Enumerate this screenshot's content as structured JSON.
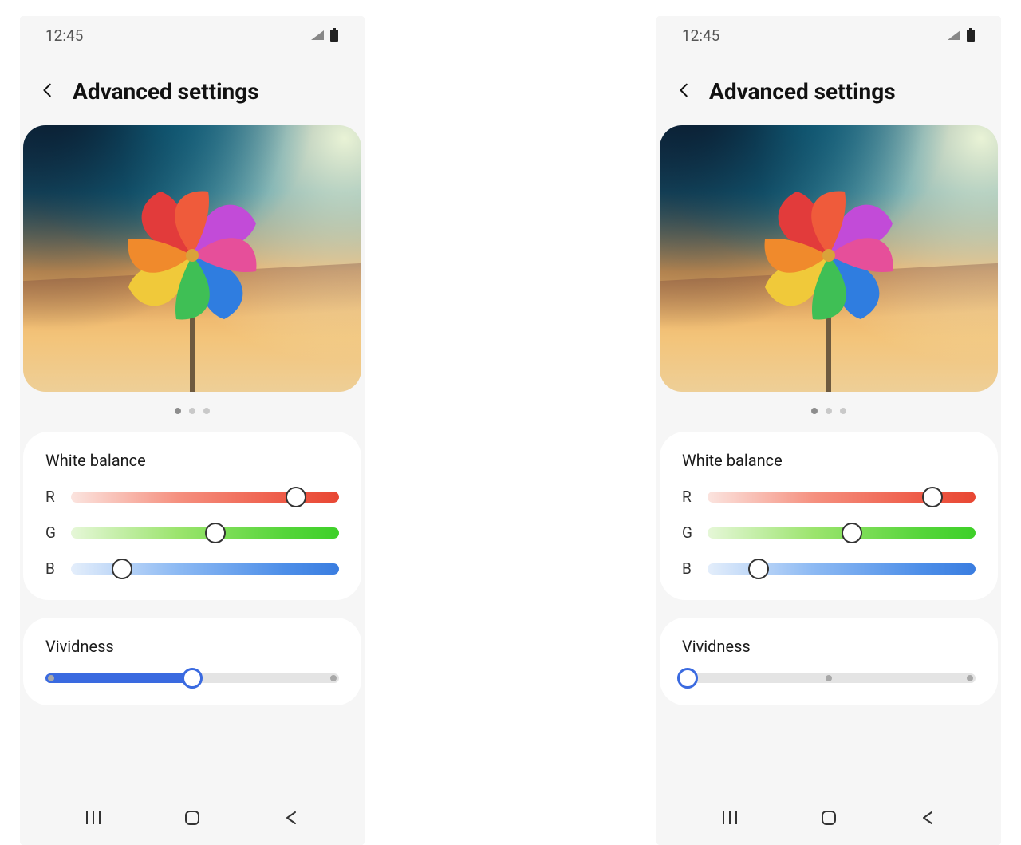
{
  "status": {
    "time": "12:45"
  },
  "page": {
    "title": "Advanced settings"
  },
  "pager": {
    "total": 3,
    "active": 0
  },
  "white_balance": {
    "title": "White balance",
    "r_label": "R",
    "g_label": "G",
    "b_label": "B",
    "r_value": 84,
    "g_value": 54,
    "b_value": 19
  },
  "vividness": {
    "title": "Vividness",
    "stops": [
      0,
      50,
      100
    ]
  },
  "screens": {
    "left": {
      "vividness_value": 50
    },
    "right": {
      "vividness_value": 0
    }
  }
}
